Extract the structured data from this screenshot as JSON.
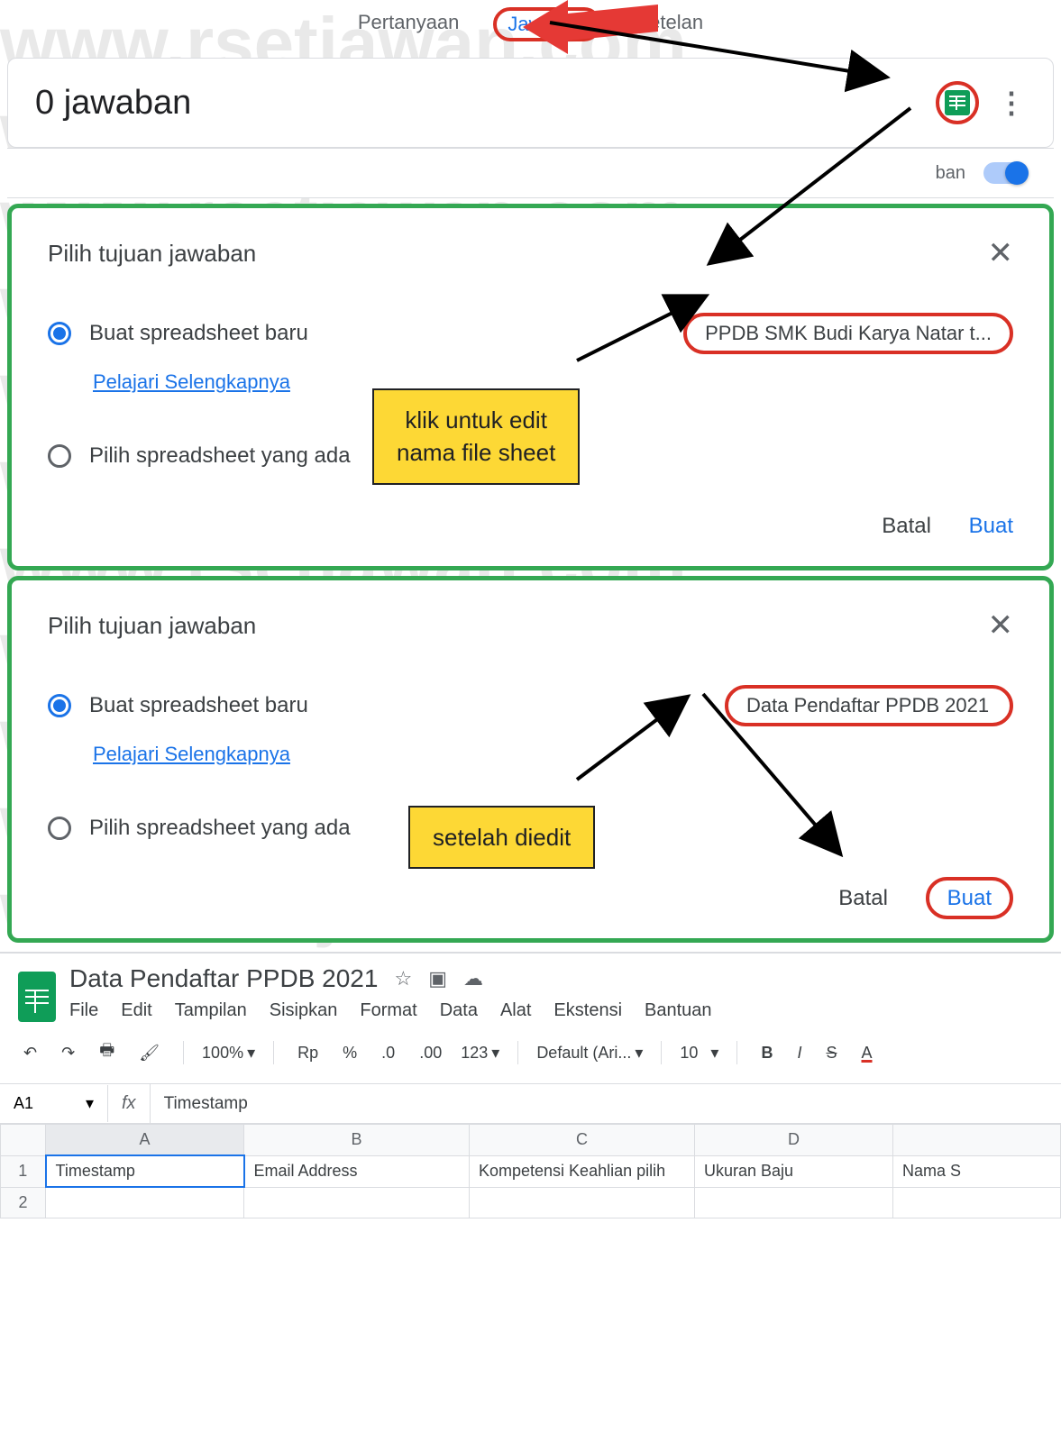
{
  "tabs": {
    "questions": "Pertanyaan",
    "responses": "Jawaban",
    "settings": "Setelan"
  },
  "responses": {
    "title": "0 jawaban",
    "accepting_suffix": "ban"
  },
  "dialog1": {
    "title": "Pilih tujuan jawaban",
    "option_new": "Buat spreadsheet baru",
    "option_existing": "Pilih spreadsheet yang ada",
    "sheet_name": "PPDB SMK Budi Karya Natar t...",
    "learn_more": "Pelajari Selengkapnya",
    "cancel": "Batal",
    "create": "Buat"
  },
  "dialog2": {
    "title": "Pilih tujuan jawaban",
    "option_new": "Buat spreadsheet baru",
    "option_existing": "Pilih spreadsheet yang ada",
    "sheet_name": "Data Pendaftar PPDB 2021",
    "learn_more": "Pelajari Selengkapnya",
    "cancel": "Batal",
    "create": "Buat"
  },
  "callouts": {
    "edit_hint": "klik untuk edit\nnama file sheet",
    "after_edit": "setelah diedit"
  },
  "sheets": {
    "title": "Data Pendaftar PPDB 2021",
    "menu": {
      "file": "File",
      "edit": "Edit",
      "view": "Tampilan",
      "insert": "Sisipkan",
      "format": "Format",
      "data": "Data",
      "tools": "Alat",
      "extensions": "Ekstensi",
      "help": "Bantuan"
    },
    "toolbar": {
      "zoom": "100%",
      "currency": "Rp",
      "percent": "%",
      "dec_dec": ".0",
      "inc_dec": ".00",
      "numfmt": "123",
      "font": "Default (Ari...",
      "size": "10"
    },
    "formula_bar": {
      "cell_ref": "A1",
      "fx": "fx",
      "content": "Timestamp"
    },
    "columns": [
      "A",
      "B",
      "C",
      "D"
    ],
    "rows": [
      "1",
      "2"
    ],
    "headers": {
      "a": "Timestamp",
      "b": "Email Address",
      "c": "Kompetensi Keahlian pilih",
      "d": "Ukuran Baju",
      "e": "Nama S"
    }
  },
  "watermark": "www.rsetjawan.com"
}
